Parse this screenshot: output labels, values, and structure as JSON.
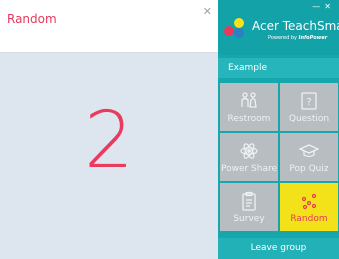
{
  "random_window": {
    "title": "Random",
    "close_icon": "close-icon",
    "number": "2"
  },
  "teachsmart": {
    "brand": "Acer TeachSmart",
    "powered_by": "Powered by",
    "powered_by_brand": "InfoPower",
    "minimize_icon": "minimize-icon",
    "close_icon": "close-icon",
    "group_label": "Example",
    "tiles": [
      {
        "label": "Restroom",
        "icon": "restroom-icon"
      },
      {
        "label": "Question",
        "icon": "question-icon"
      },
      {
        "label": "Power Share",
        "icon": "power-share-icon"
      },
      {
        "label": "Pop Quiz",
        "icon": "graduation-cap-icon"
      },
      {
        "label": "Survey",
        "icon": "clipboard-icon"
      },
      {
        "label": "Random",
        "icon": "random-dots-icon",
        "active": true
      }
    ],
    "leave_group": "Leave group",
    "colors": {
      "accent": "#16a7ad",
      "tile": "#b7bdc0",
      "active_tile": "#f3e21a",
      "random_red": "#ea3a5e"
    }
  }
}
